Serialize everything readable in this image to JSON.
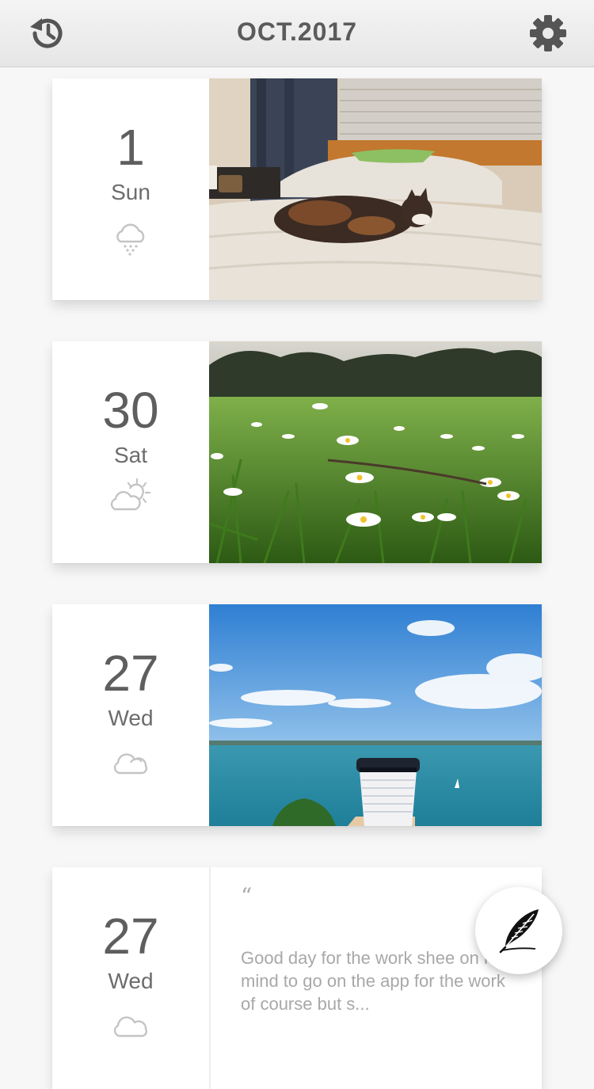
{
  "header": {
    "title": "OCT.2017",
    "left_icon": "history-icon",
    "right_icon": "gear-icon"
  },
  "entries": [
    {
      "day": "1",
      "weekday": "Sun",
      "weather_icon": "rain-cloud-icon",
      "photo": "cat-on-bed"
    },
    {
      "day": "30",
      "weekday": "Sat",
      "weather_icon": "partly-sunny-icon",
      "photo": "daisy-field"
    },
    {
      "day": "27",
      "weekday": "Wed",
      "weather_icon": "cloudy-icon",
      "photo": "sea-view-coffee-cup"
    },
    {
      "day": "27",
      "weekday": "Wed",
      "weather_icon": "cloudy-icon",
      "quote_mark": "“",
      "text": "Good day for the work shee on my mind to go on the app for the work of course but s..."
    }
  ],
  "fab": {
    "icon": "feather-quill-icon"
  },
  "colors": {
    "accent": "#5b5b5b",
    "background": "#f7f7f7",
    "card": "#ffffff"
  }
}
